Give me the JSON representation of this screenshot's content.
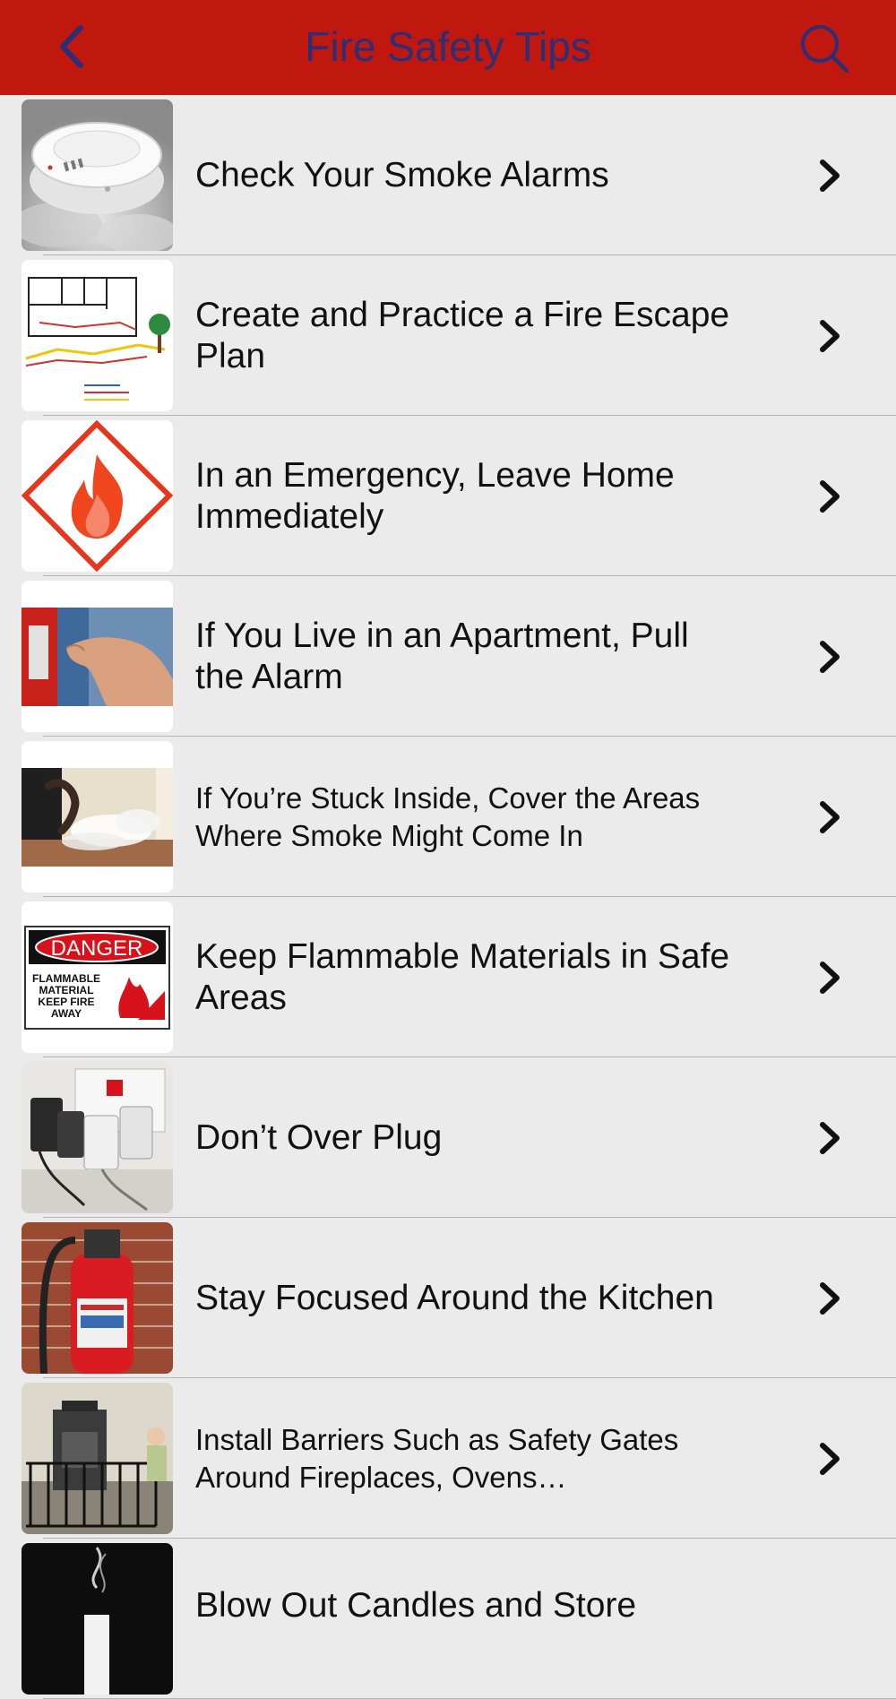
{
  "header": {
    "title": "Fire Safety Tips",
    "back_icon": "chevron-left-icon",
    "search_icon": "search-icon",
    "background_color": "#c0180e",
    "accent_color": "#2b2f78"
  },
  "tips": [
    {
      "label": "Check Your Smoke Alarms"
    },
    {
      "label": "Create and Practice a Fire Escape Plan"
    },
    {
      "label": "In an Emergency, Leave Home Immediately"
    },
    {
      "label": "If You Live in an Apartment, Pull the Alarm"
    },
    {
      "label": "If You’re Stuck Inside, Cover the Areas Where Smoke Might Come In"
    },
    {
      "label": "Keep Flammable Materials in Safe Areas",
      "sign_title": "DANGER",
      "sign_text": [
        "FLAMMABLE",
        "MATERIAL",
        "KEEP FIRE",
        "AWAY"
      ]
    },
    {
      "label": "Don’t Over Plug"
    },
    {
      "label": "Stay Focused Around the Kitchen"
    },
    {
      "label": "Install Barriers Such as Safety Gates Around Fireplaces, Ovens…"
    },
    {
      "label": "Blow Out Candles and Store"
    }
  ]
}
